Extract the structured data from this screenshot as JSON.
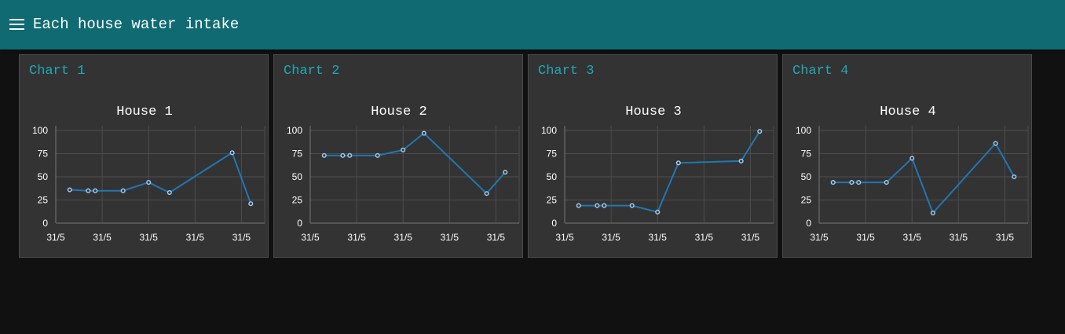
{
  "header": {
    "title": "Each house water intake"
  },
  "colors": {
    "header_bg": "#0f6a72",
    "card_bg": "#333333",
    "card_title": "#1fa9b8",
    "series_line": "#1f77b4",
    "grid": "#4d4d4d"
  },
  "cards": [
    {
      "label": "Chart 1"
    },
    {
      "label": "Chart 2"
    },
    {
      "label": "Chart 3"
    },
    {
      "label": "Chart 4"
    }
  ],
  "chart_data": [
    {
      "type": "line",
      "title": "House 1",
      "y_ticks": [
        100,
        75,
        50,
        25,
        0
      ],
      "ylim": [
        0,
        100
      ],
      "x_ticks": [
        "31/5",
        "31/5",
        "31/5",
        "31/5",
        "31/5"
      ],
      "x": [
        0.3,
        0.7,
        0.85,
        1.45,
        2.0,
        2.45,
        3.8,
        4.2
      ],
      "values": [
        36,
        35,
        35,
        35,
        44,
        33,
        76,
        21
      ],
      "grid": true,
      "legend": "none"
    },
    {
      "type": "line",
      "title": "House 2",
      "y_ticks": [
        100,
        75,
        50,
        25,
        0
      ],
      "ylim": [
        0,
        100
      ],
      "x_ticks": [
        "31/5",
        "31/5",
        "31/5",
        "31/5",
        "31/5"
      ],
      "x": [
        0.3,
        0.7,
        0.85,
        1.45,
        2.0,
        2.45,
        3.8,
        4.2
      ],
      "values": [
        73,
        73,
        73,
        73,
        79,
        97,
        32,
        55
      ],
      "grid": true,
      "legend": "none"
    },
    {
      "type": "line",
      "title": "House 3",
      "y_ticks": [
        100,
        75,
        50,
        25,
        0
      ],
      "ylim": [
        0,
        100
      ],
      "x_ticks": [
        "31/5",
        "31/5",
        "31/5",
        "31/5",
        "31/5"
      ],
      "x": [
        0.3,
        0.7,
        0.85,
        1.45,
        2.0,
        2.45,
        3.8,
        4.2
      ],
      "values": [
        19,
        19,
        19,
        19,
        12,
        65,
        67,
        99
      ],
      "grid": true,
      "legend": "none"
    },
    {
      "type": "line",
      "title": "House 4",
      "y_ticks": [
        100,
        75,
        50,
        25,
        0
      ],
      "ylim": [
        0,
        100
      ],
      "x_ticks": [
        "31/5",
        "31/5",
        "31/5",
        "31/5",
        "31/5"
      ],
      "x": [
        0.3,
        0.7,
        0.85,
        1.45,
        2.0,
        2.45,
        3.8,
        4.2
      ],
      "values": [
        44,
        44,
        44,
        44,
        70,
        11,
        86,
        50
      ],
      "grid": true,
      "legend": "none"
    }
  ]
}
